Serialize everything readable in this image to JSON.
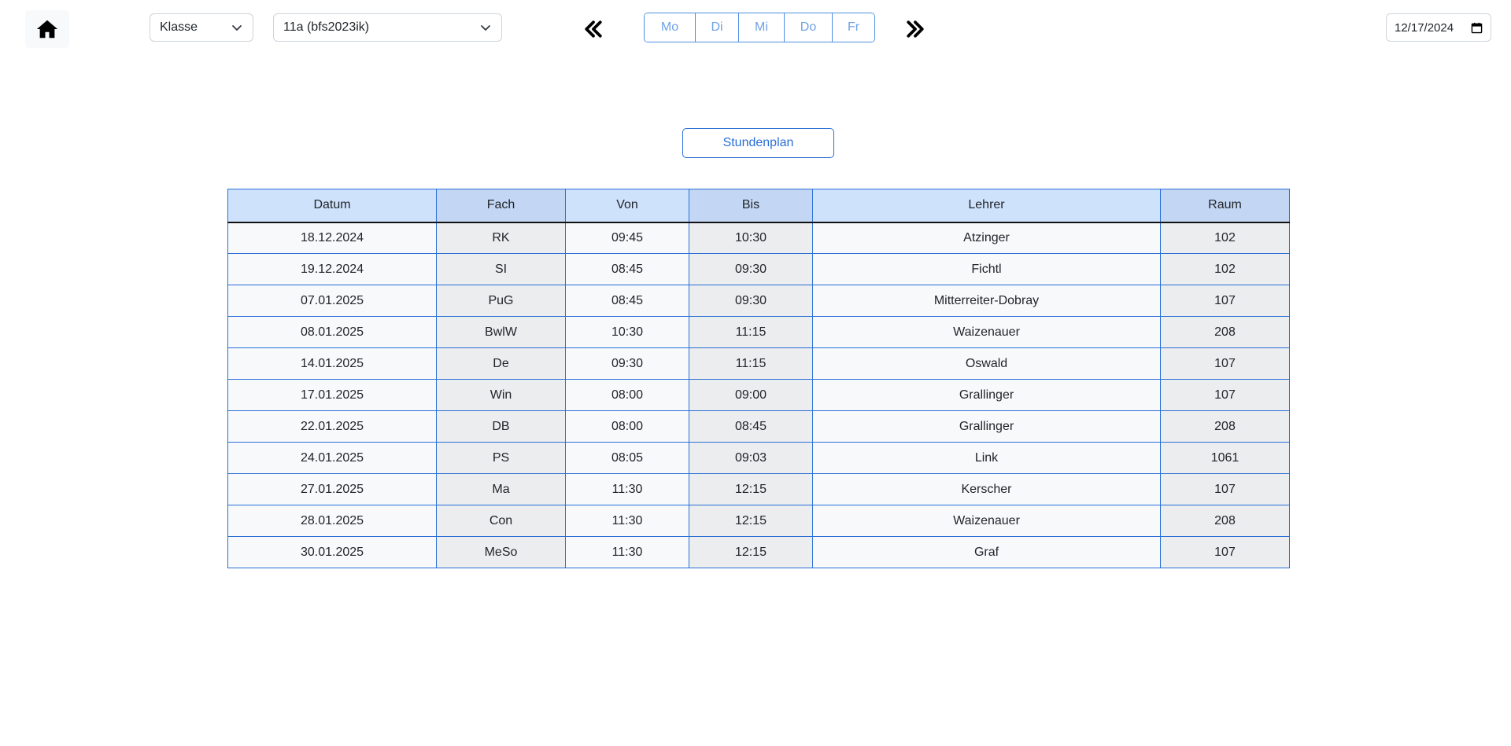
{
  "topbar": {
    "home_icon": "home-icon",
    "type_select": {
      "value": "Klasse"
    },
    "class_select": {
      "value": "11a (bfs2023ik)"
    },
    "prev_icon": "double-chevron-left-icon",
    "next_icon": "double-chevron-right-icon",
    "days": [
      {
        "label": "Mo"
      },
      {
        "label": "Di"
      },
      {
        "label": "Mi"
      },
      {
        "label": "Do"
      },
      {
        "label": "Fr"
      }
    ],
    "date_input": {
      "value": "12/17/2024",
      "icon": "calendar-icon"
    }
  },
  "stundenplan_button": {
    "label": "Stundenplan"
  },
  "table": {
    "headers": [
      "Datum",
      "Fach",
      "Von",
      "Bis",
      "Lehrer",
      "Raum"
    ],
    "rows": [
      [
        "18.12.2024",
        "RK",
        "09:45",
        "10:30",
        "Atzinger",
        "102"
      ],
      [
        "19.12.2024",
        "SI",
        "08:45",
        "09:30",
        "Fichtl",
        "102"
      ],
      [
        "07.01.2025",
        "PuG",
        "08:45",
        "09:30",
        "Mitterreiter-Dobray",
        "107"
      ],
      [
        "08.01.2025",
        "BwlW",
        "10:30",
        "11:15",
        "Waizenauer",
        "208"
      ],
      [
        "14.01.2025",
        "De",
        "09:30",
        "11:15",
        "Oswald",
        "107"
      ],
      [
        "17.01.2025",
        "Win",
        "08:00",
        "09:00",
        "Grallinger",
        "107"
      ],
      [
        "22.01.2025",
        "DB",
        "08:00",
        "08:45",
        "Grallinger",
        "208"
      ],
      [
        "24.01.2025",
        "PS",
        "08:05",
        "09:03",
        "Link",
        "1061"
      ],
      [
        "27.01.2025",
        "Ma",
        "11:30",
        "12:15",
        "Kerscher",
        "107"
      ],
      [
        "28.01.2025",
        "Con",
        "11:30",
        "12:15",
        "Waizenauer",
        "208"
      ],
      [
        "30.01.2025",
        "MeSo",
        "11:30",
        "12:15",
        "Graf",
        "107"
      ]
    ]
  },
  "colors": {
    "accent": "#2a6fd6",
    "header_light": "#cfe2fc",
    "header_dark": "#c3d6f3"
  }
}
